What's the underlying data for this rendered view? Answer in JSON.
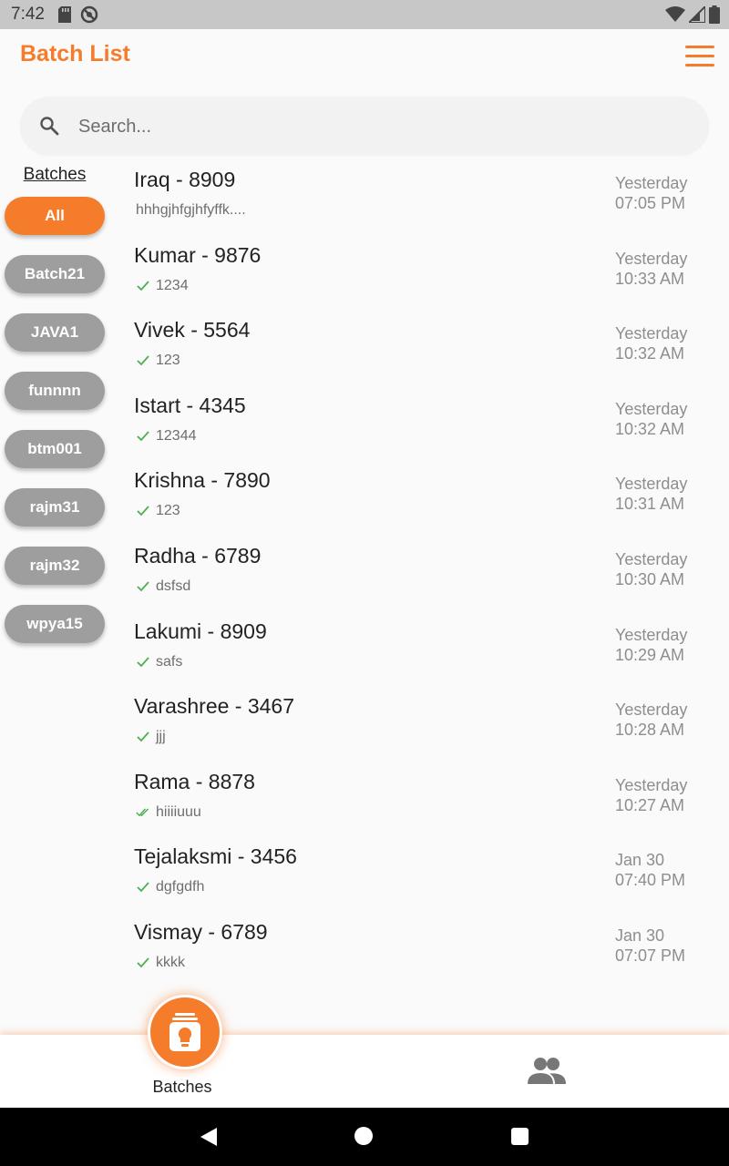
{
  "status_bar": {
    "time": "7:42"
  },
  "app_bar": {
    "title": "Batch List"
  },
  "search": {
    "placeholder": "Search..."
  },
  "sidebar": {
    "heading": "Batches",
    "chips": [
      {
        "label": "All",
        "active": true
      },
      {
        "label": "Batch21",
        "active": false
      },
      {
        "label": "JAVA1",
        "active": false
      },
      {
        "label": "funnnn",
        "active": false
      },
      {
        "label": "btm001",
        "active": false
      },
      {
        "label": "rajm31",
        "active": false
      },
      {
        "label": "rajm32",
        "active": false
      },
      {
        "label": "wpya15",
        "active": false
      }
    ]
  },
  "chats": [
    {
      "name": "Iraq - 8909",
      "preview": "hhhgjhfgjhfyffk....",
      "tick": "none",
      "date": "Yesterday",
      "time": "07:05 PM"
    },
    {
      "name": "Kumar - 9876",
      "preview": "1234",
      "tick": "single",
      "date": "Yesterday",
      "time": "10:33 AM"
    },
    {
      "name": "Vivek - 5564",
      "preview": "123",
      "tick": "single",
      "date": "Yesterday",
      "time": "10:32 AM"
    },
    {
      "name": "Istart - 4345",
      "preview": "12344",
      "tick": "single",
      "date": "Yesterday",
      "time": "10:32 AM"
    },
    {
      "name": "Krishna - 7890",
      "preview": "123",
      "tick": "single",
      "date": "Yesterday",
      "time": "10:31 AM"
    },
    {
      "name": "Radha - 6789",
      "preview": "dsfsd",
      "tick": "single",
      "date": "Yesterday",
      "time": "10:30 AM"
    },
    {
      "name": "Lakumi - 8909",
      "preview": "safs",
      "tick": "single",
      "date": "Yesterday",
      "time": "10:29 AM"
    },
    {
      "name": "Varashree - 3467",
      "preview": "jjj",
      "tick": "single",
      "date": "Yesterday",
      "time": "10:28 AM"
    },
    {
      "name": "Rama - 8878",
      "preview": "hiiiiuuu",
      "tick": "double",
      "date": "Yesterday",
      "time": "10:27 AM"
    },
    {
      "name": "Tejalaksmi - 3456",
      "preview": "dgfgdfh",
      "tick": "single",
      "date": "Jan 30",
      "time": "07:40 PM"
    },
    {
      "name": "Vismay - 6789",
      "preview": "kkkk",
      "tick": "single",
      "date": "Jan 30",
      "time": "07:07 PM"
    }
  ],
  "bottom_nav": {
    "batches_label": "Batches"
  },
  "colors": {
    "accent": "#f57c2a",
    "chip_inactive": "#9e9e9e",
    "tick": "#4caf50"
  }
}
